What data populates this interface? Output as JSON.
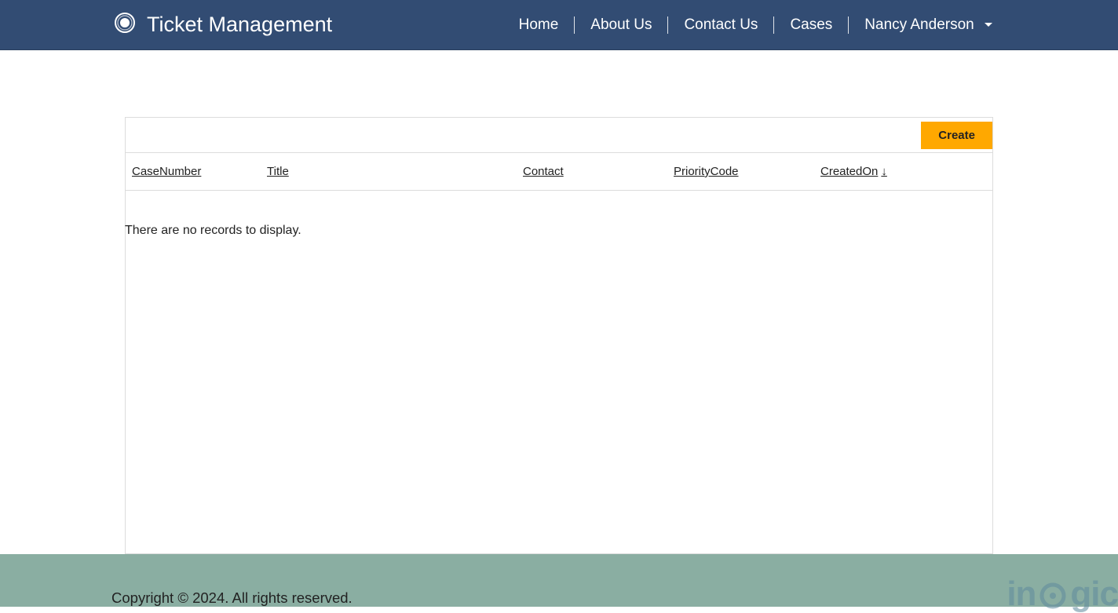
{
  "header": {
    "app_title": "Ticket Management",
    "nav": {
      "home": "Home",
      "about": "About Us",
      "contact": "Contact Us",
      "cases": "Cases",
      "user": "Nancy Anderson"
    }
  },
  "panel": {
    "create_label": "Create",
    "columns": {
      "case_number": "CaseNumber",
      "title": "Title",
      "contact": "Contact",
      "priority_code": "PriorityCode",
      "created_on": "CreatedOn"
    },
    "sort_indicator": "↓",
    "empty_message": "There are no records to display."
  },
  "footer": {
    "copyright": "Copyright © 2024. All rights reserved.",
    "watermark": "inogic"
  }
}
